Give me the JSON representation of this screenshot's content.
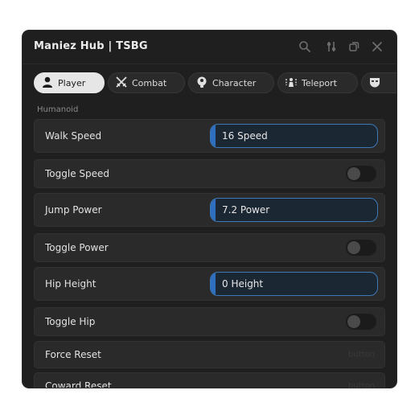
{
  "window": {
    "title": "Maniez Hub | TSBG"
  },
  "controls": [
    {
      "name": "search-icon"
    },
    {
      "name": "settings-icon"
    },
    {
      "name": "minimize-icon"
    },
    {
      "name": "close-icon"
    }
  ],
  "tabs": [
    {
      "label": "Player",
      "icon": "user-icon",
      "active": true
    },
    {
      "label": "Combat",
      "icon": "crossed-swords-icon",
      "active": false
    },
    {
      "label": "Character",
      "icon": "character-icon",
      "active": false
    },
    {
      "label": "Teleport",
      "icon": "teleport-icon",
      "active": false
    },
    {
      "label": "",
      "icon": "mask-icon",
      "active": false
    }
  ],
  "section": {
    "label": "Humanoid"
  },
  "rows": [
    {
      "label": "Walk Speed",
      "type": "slider",
      "value_text": "16 Speed",
      "fill": 0.02
    },
    {
      "label": "Toggle Speed",
      "type": "toggle",
      "on": false
    },
    {
      "label": "Jump Power",
      "type": "slider",
      "value_text": "7.2 Power",
      "fill": 0.02
    },
    {
      "label": "Toggle Power",
      "type": "toggle",
      "on": false
    },
    {
      "label": "Hip Height",
      "type": "slider",
      "value_text": "0 Height",
      "fill": 0.02
    },
    {
      "label": "Toggle Hip",
      "type": "toggle",
      "on": false
    },
    {
      "label": "Force Reset",
      "type": "button",
      "hint": "button"
    },
    {
      "label": "Coward Reset",
      "type": "button",
      "hint": "button"
    }
  ],
  "colors": {
    "accent": "#2f6fbf",
    "background": "#1f1f1f",
    "row": "#2a2a2a"
  }
}
